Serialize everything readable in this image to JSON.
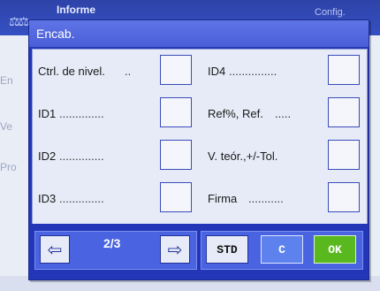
{
  "background": {
    "app_title": "Informe",
    "right_text": "Config.",
    "side_labels": [
      "En",
      "Ve",
      "Pro"
    ]
  },
  "dialog": {
    "title": "Encab."
  },
  "options": [
    {
      "label": "Ctrl. de nivel.",
      "dots": " ..",
      "checked": false
    },
    {
      "label": "ID1",
      "dots": " ..............",
      "checked": false
    },
    {
      "label": "ID2",
      "dots": " ..............",
      "checked": false
    },
    {
      "label": "ID3",
      "dots": " ..............",
      "checked": false
    },
    {
      "label": "ID4",
      "dots": " ...............",
      "checked": false
    },
    {
      "label": "Ref%, Ref.",
      "dots": " .....",
      "checked": false
    },
    {
      "label": "V. teór.,+/-Tol.",
      "dots": "",
      "checked": false
    },
    {
      "label": "Firma",
      "dots": " ...........",
      "checked": false
    }
  ],
  "footer": {
    "prev_icon": "arrow-left-icon",
    "next_icon": "arrow-right-icon",
    "page": "2/3",
    "std_label": "STD",
    "c_label": "C",
    "ok_label": "OK"
  },
  "colors": {
    "dialog_frame": "#2436b8",
    "header": "#4a5fd8",
    "body": "#e7ebf7",
    "ok_button": "#58b81e",
    "c_button": "#5d82ee"
  }
}
